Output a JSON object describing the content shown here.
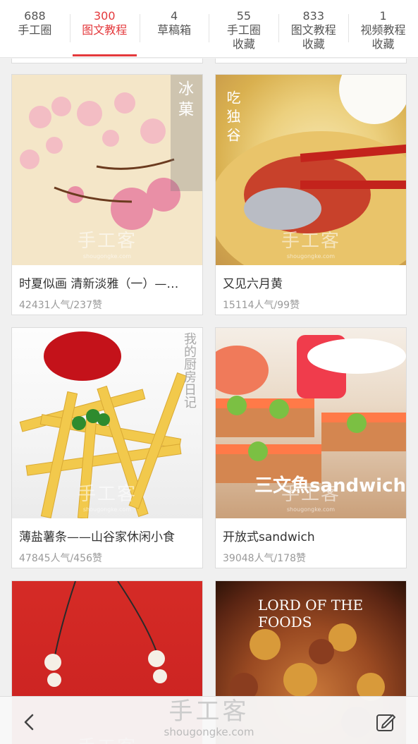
{
  "tabs": [
    {
      "count": "688",
      "label": "手工圈",
      "active": false
    },
    {
      "count": "300",
      "label": "图文教程",
      "active": true
    },
    {
      "count": "4",
      "label": "草稿箱",
      "active": false
    },
    {
      "count": "55",
      "label": "手工圈\n收藏",
      "active": false
    },
    {
      "count": "833",
      "label": "图文教程\n收藏",
      "active": false
    },
    {
      "count": "1",
      "label": "视频教程\n收藏",
      "active": false
    }
  ],
  "tab_labels": {
    "t0": "手工圈",
    "t1": "图文教程",
    "t2": "草稿箱",
    "t3a": "手工圈",
    "t3b": "收藏",
    "t4a": "图文教程",
    "t4b": "收藏",
    "t5a": "视频教程",
    "t5b": "收藏"
  },
  "cards": [
    {
      "title": "时夏似画 清新淡雅（一）—…",
      "stats": "42431人气/237赞",
      "overlay": "冰 菓"
    },
    {
      "title": "又见六月黄",
      "stats": "15114人气/99赞",
      "overlay": "吃 独 谷"
    },
    {
      "title": "薄盐薯条——山谷家休闲小食",
      "stats": "47845人气/456赞",
      "overlay": "我的厨房日记"
    },
    {
      "title": "开放式sandwich",
      "stats": "39048人气/178赞",
      "overlay": "三文魚sandwich"
    },
    {
      "title": "",
      "stats": "",
      "overlay": ""
    },
    {
      "title": "",
      "stats": "",
      "overlay": "LORD OF THE FOODS"
    }
  ],
  "watermark": {
    "cn": "手工客",
    "en": "shougongke.com"
  },
  "accent_color": "#e4393c",
  "bottombar": {
    "back_icon": "chevron-left-icon",
    "edit_icon": "edit-icon",
    "brand_cn": "手工客",
    "brand_en": "shougongke.com"
  }
}
